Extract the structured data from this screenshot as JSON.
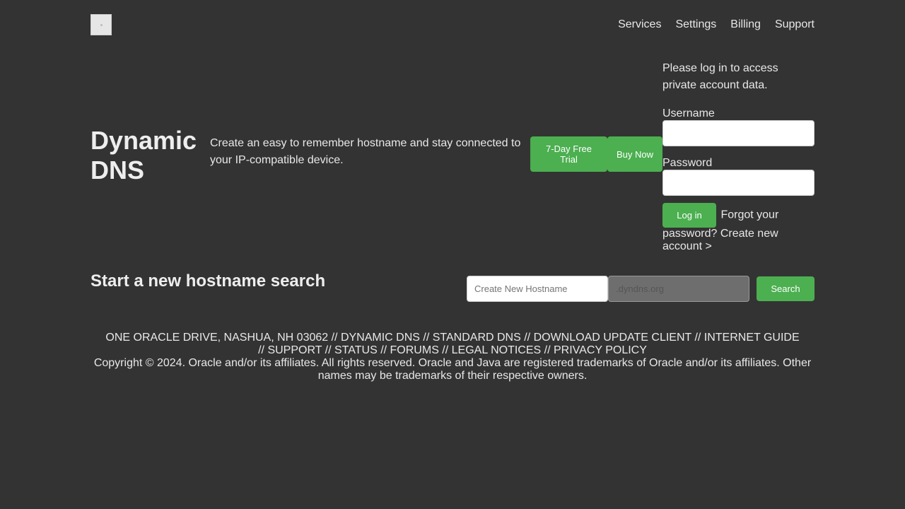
{
  "header": {
    "nav": [
      "Services",
      "Settings",
      "Billing",
      "Support"
    ]
  },
  "hero": {
    "title": "Dynamic DNS",
    "description": "Create an easy to remember hostname and stay connected to your IP-compatible device.",
    "trial_label": "7-Day Free Trial",
    "buy_label": "Buy Now"
  },
  "login": {
    "message": "Please log in to access private account data.",
    "username_label": "Username",
    "password_label": "Password",
    "login_button": "Log in",
    "forgot_link": "Forgot your password?",
    "create_link": "Create new account >"
  },
  "search": {
    "title": "Start a new hostname search",
    "hostname_placeholder": "Create New Hostname",
    "domain_placeholder": ".dyndns.org",
    "button": "Search"
  },
  "footer": {
    "address": "ONE ORACLE DRIVE, NASHUA, NH 03062",
    "links": [
      "DYNAMIC DNS",
      "STANDARD DNS",
      "DOWNLOAD UPDATE CLIENT",
      "INTERNET GUIDE",
      "SUPPORT",
      "STATUS",
      "FORUMS",
      "LEGAL NOTICES",
      "PRIVACY POLICY"
    ],
    "separator": " // ",
    "copyright": "Copyright © 2024. Oracle and/or its affiliates. All rights reserved. Oracle and Java are registered trademarks of Oracle and/or its affiliates. Other names may be trademarks of their respective owners."
  }
}
